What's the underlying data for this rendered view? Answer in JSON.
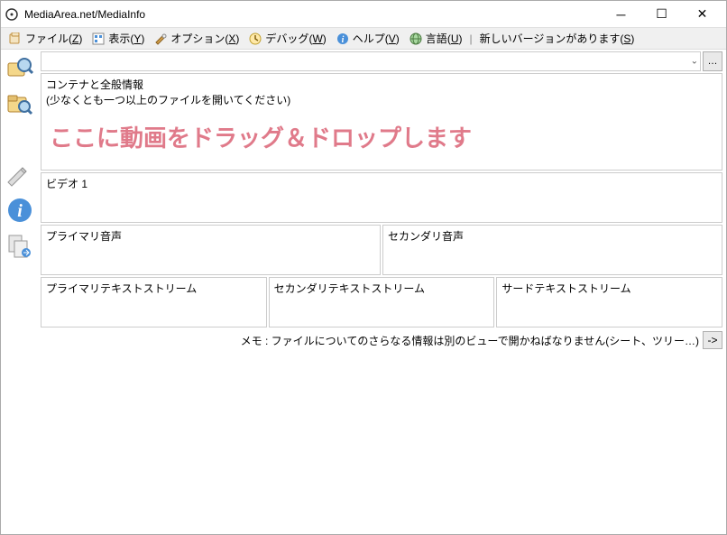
{
  "window": {
    "title": "MediaArea.net/MediaInfo"
  },
  "menu": {
    "file": {
      "label": "ファイル",
      "key": "Z"
    },
    "view": {
      "label": "表示",
      "key": "Y"
    },
    "options": {
      "label": "オプション",
      "key": "X"
    },
    "debug": {
      "label": "デバッグ",
      "key": "W"
    },
    "help": {
      "label": "ヘルプ",
      "key": "V"
    },
    "language": {
      "label": "言語",
      "key": "U"
    },
    "update": {
      "label": "新しいバージョンがあります",
      "key": "S"
    }
  },
  "path": {
    "value": "",
    "browse": "…"
  },
  "panels": {
    "container": {
      "title": "コンテナと全般情報",
      "sub": "(少なくとも一つ以上のファイルを開いてください)",
      "hint": "ここに動画をドラッグ＆ドロップします"
    },
    "video": {
      "title": "ビデオ 1"
    },
    "audio1": {
      "title": "プライマリ音声"
    },
    "audio2": {
      "title": "セカンダリ音声"
    },
    "text1": {
      "title": "プライマリテキストストリーム"
    },
    "text2": {
      "title": "セカンダリテキストストリーム"
    },
    "text3": {
      "title": "サードテキストストリーム"
    }
  },
  "note": {
    "text": "メモ : ファイルについてのさらなる情報は別のビューで開かねばなりません(シート、ツリー…)",
    "go": "->"
  }
}
